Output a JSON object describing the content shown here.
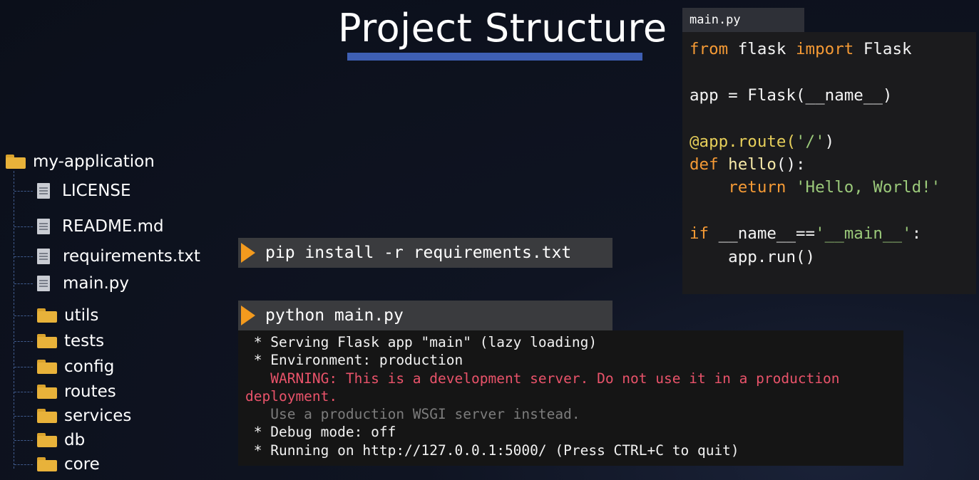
{
  "slide": {
    "title": "Project Structure",
    "accent_color": "#3e5fb3"
  },
  "tree": {
    "root": {
      "label": "my-application",
      "icon": "folder-icon"
    },
    "files": [
      {
        "label": "LICENSE",
        "icon": "file-icon"
      },
      {
        "label": "README.md",
        "icon": "file-icon"
      },
      {
        "label": "requirements.txt",
        "icon": "file-icon"
      },
      {
        "label": "main.py",
        "icon": "file-icon"
      }
    ],
    "folders": [
      {
        "label": "utils",
        "icon": "folder-icon"
      },
      {
        "label": "tests",
        "icon": "folder-icon"
      },
      {
        "label": "config",
        "icon": "folder-icon"
      },
      {
        "label": "routes",
        "icon": "folder-icon"
      },
      {
        "label": "services",
        "icon": "folder-icon"
      },
      {
        "label": "db",
        "icon": "folder-icon"
      },
      {
        "label": "core",
        "icon": "folder-icon"
      }
    ]
  },
  "commands": {
    "install": "pip install -r requirements.txt",
    "run": "python main.py",
    "arrow_color": "#f39a1e"
  },
  "terminal": {
    "lines": [
      " * Serving Flask app \"main\" (lazy loading)",
      " * Environment: production",
      "   WARNING: This is a development server. Do not use it in a production",
      "deployment.",
      "   Use a production WSGI server instead.",
      " * Debug mode: off",
      " * Running on http://127.0.0.1:5000/ (Press CTRL+C to quit)"
    ],
    "warning_color": "#e9536a"
  },
  "code": {
    "tab_label": "main.py",
    "tokens": {
      "from": "from",
      "flask": " flask ",
      "import": "import",
      "Flask": " Flask",
      "app_assign": "app = Flask(__name__)",
      "decorator": "@app.route(",
      "route_str": "'/'",
      "close_paren": ")",
      "def": "def",
      "hello": " hello",
      "hello_tail": "():",
      "return_indent": "    ",
      "return": "return",
      "hello_str": " 'Hello, World!'",
      "if": "if",
      "name_cmp": " __name__==",
      "main_str": "'__main__'",
      "colon": ":",
      "run_line": "    app.run()"
    }
  }
}
